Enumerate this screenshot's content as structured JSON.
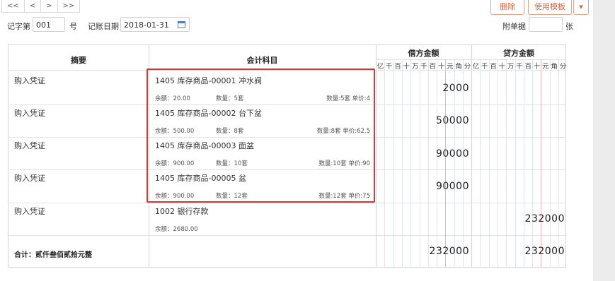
{
  "pager": [
    "<<",
    "<",
    ">",
    ">>"
  ],
  "toolbar": {
    "delete_label": "删除",
    "template_label": "使用模板",
    "dropdown_glyph": "▾"
  },
  "form": {
    "voucher_word_label": "记字第",
    "voucher_number": "001",
    "voucher_unit": "号",
    "date_label": "记账日期",
    "date_value": "2018-01-31",
    "attachments_label": "附单据",
    "attachments_value": "",
    "attachments_unit": "张"
  },
  "table": {
    "headers": {
      "summary": "摘要",
      "account": "会计科目",
      "debit": "借方金额",
      "credit": "贷方金额"
    },
    "units": [
      "亿",
      "千",
      "百",
      "十",
      "万",
      "千",
      "百",
      "十",
      "元",
      "角",
      "分"
    ],
    "rows": [
      {
        "summary": "购入凭证",
        "account": "1405 库存商品-00001 冲水阀",
        "balance": "余额：20.00",
        "qty": "数量：5套",
        "price": "数量:5套 单价:4",
        "debit": "2000",
        "credit": ""
      },
      {
        "summary": "购入凭证",
        "account": "1405 库存商品-00002 台下盆",
        "balance": "余额：500.00",
        "qty": "数量：8套",
        "price": "数量:8套 单价:62.5",
        "debit": "50000",
        "credit": ""
      },
      {
        "summary": "购入凭证",
        "account": "1405 库存商品-00003 面盆",
        "balance": "余额：900.00",
        "qty": "数量：10套",
        "price": "数量:10套 单价:90",
        "debit": "90000",
        "credit": ""
      },
      {
        "summary": "购入凭证",
        "account": "1405 库存商品-00005 盆",
        "balance": "余额：900.00",
        "qty": "数量：12套",
        "price": "数量:12套 单价:75",
        "debit": "90000",
        "credit": ""
      },
      {
        "summary": "购入凭证",
        "account": "1002 银行存款",
        "balance": "余额：2680.00",
        "qty": "",
        "price": "",
        "debit": "",
        "credit": "232000"
      }
    ],
    "total": {
      "label": "合计：贰仟叁佰贰拾元整",
      "debit": "232000",
      "credit": "232000"
    }
  },
  "colors": {
    "accent": "#e0663a",
    "highlight_border": "#d9383a",
    "calendar_icon": "#3f85c6"
  }
}
